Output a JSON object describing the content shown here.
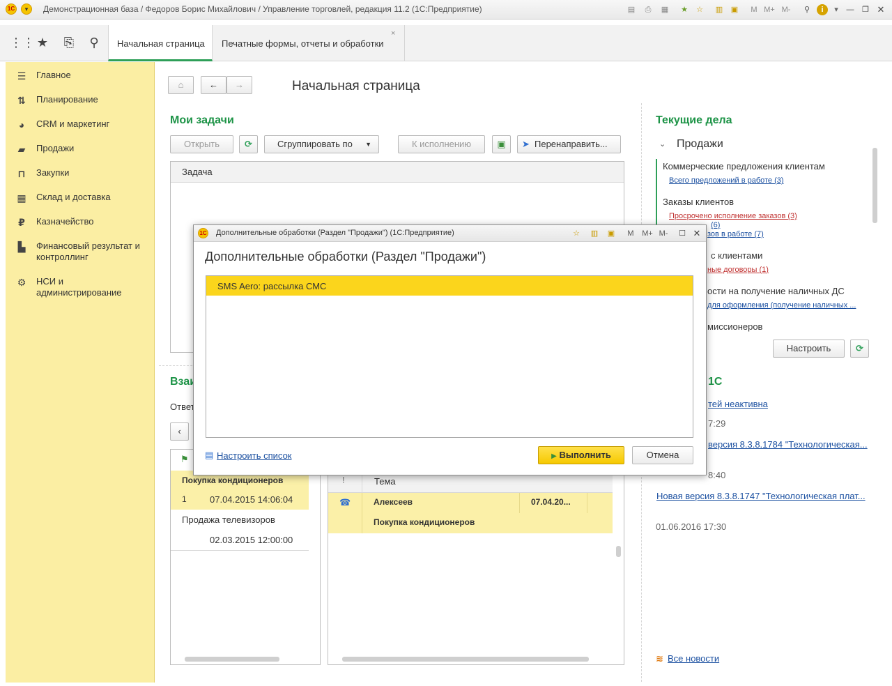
{
  "titlebar": {
    "title": "Демонстрационная база / Федоров Борис Михайлович / Управление торговлей, редакция 11.2  (1С:Предприятие)"
  },
  "toppanel": {
    "tabs": [
      {
        "label": "Начальная страница"
      },
      {
        "label": "Печатные формы, отчеты и обработки"
      }
    ]
  },
  "sidebar": {
    "items": [
      {
        "label": "Главное",
        "icon": "menu-lines-icon"
      },
      {
        "label": "Планирование",
        "icon": "planning-icon"
      },
      {
        "label": "CRM и маркетинг",
        "icon": "pie-chart-icon"
      },
      {
        "label": "Продажи",
        "icon": "bag-icon"
      },
      {
        "label": "Закупки",
        "icon": "cart-icon"
      },
      {
        "label": "Склад и доставка",
        "icon": "warehouse-icon"
      },
      {
        "label": "Казначейство",
        "icon": "ruble-icon"
      },
      {
        "label": "Финансовый результат и контроллинг",
        "icon": "bar-chart-icon"
      },
      {
        "label": "НСИ и администрирование",
        "icon": "gear-icon"
      }
    ]
  },
  "main": {
    "page_title": "Начальная страница",
    "tasks": {
      "title": "Мои задачи",
      "open_btn": "Открыть",
      "group_btn": "Сгруппировать по",
      "execute_btn": "К исполнению",
      "redirect_btn": "Перенаправить...",
      "column": "Задача"
    },
    "interactions": {
      "title_part": "Взаи",
      "filter_part": "Ответ",
      "list": [
        {
          "subject": "Покупка кондиционеров",
          "count": "1",
          "date": "07.04.2015 14:06:04"
        },
        {
          "subject": "Продажа телевизоров",
          "count": "",
          "date": "02.03.2015 12:00:00"
        }
      ],
      "detail_header": "Тема",
      "detail_row": {
        "name": "Алексеев",
        "date": "07.04.20...",
        "topic": "Покупка кондиционеров"
      }
    },
    "current": {
      "title": "Текущие дела",
      "section": "Продажи",
      "groups": [
        {
          "title": "Коммерческие предложения клиентам",
          "links": [
            {
              "text": "Всего предложений в работе (3)",
              "style": "blue"
            }
          ]
        },
        {
          "title": "Заказы клиентов",
          "links": [
            {
              "text": "Просрочено исполнение заказов (3)",
              "style": "red"
            },
            {
              "text": "(6)",
              "style": "blue"
            },
            {
              "text": "зов в работе (7)",
              "style": "blue"
            }
          ]
        },
        {
          "title": "с клиентами",
          "links": [
            {
              "text": "ные договоры (1)",
              "style": "red"
            }
          ]
        },
        {
          "title": "ости на получение наличных ДС",
          "links": [
            {
              "text": "для оформления (получение наличных ...",
              "style": "blue"
            }
          ]
        },
        {
          "title": "миссионеров",
          "links": []
        }
      ],
      "configure_btn": "Настроить"
    },
    "news": {
      "title_part": "1С",
      "items": [
        {
          "text": "тей неактивна",
          "style": "link"
        },
        {
          "text": "7:29",
          "style": "date"
        },
        {
          "text": "версия 8.3.8.1784 \"Технологическая...",
          "style": "link"
        },
        {
          "text": "8:40",
          "style": "date"
        },
        {
          "text": "Новая версия 8.3.8.1747 \"Технологическая плат...",
          "style": "link"
        },
        {
          "text": "01.06.2016 17:30",
          "style": "date"
        }
      ],
      "all_news": "Все новости"
    }
  },
  "dialog": {
    "window_title": "Дополнительные обработки (Раздел \"Продажи\")  (1С:Предприятие)",
    "heading": "Дополнительные обработки (Раздел \"Продажи\")",
    "items": [
      {
        "label": "SMS Aero:  рассылка СМС"
      }
    ],
    "configure_link": "Настроить список",
    "run_btn": "Выполнить",
    "cancel_btn": "Отмена",
    "title_buttons": [
      "M",
      "M+",
      "M-"
    ]
  },
  "colors": {
    "accent_green": "#1c9346",
    "sidebar_bg": "#fbeea3",
    "selection_yellow": "#fbd51c",
    "link_blue": "#1a4fa0",
    "link_red": "#c0302f"
  }
}
